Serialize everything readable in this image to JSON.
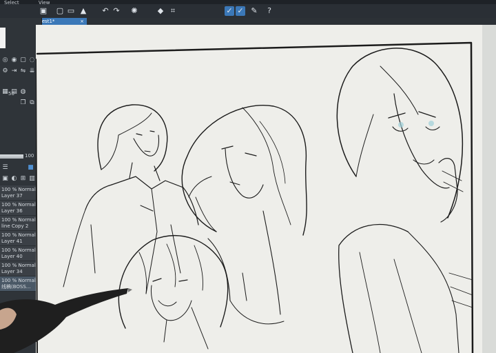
{
  "menubar": {
    "items": [
      "Select",
      "View"
    ]
  },
  "toolbar": {
    "icons": [
      "app-icon",
      "new-file-icon",
      "open-file-icon",
      "save-icon",
      "undo-icon",
      "redo-icon",
      "loading-icon",
      "fill-icon",
      "transform-icon",
      "check-icon",
      "check-active-icon",
      "edit-icon",
      "help-icon"
    ]
  },
  "tabs": [
    {
      "label": "test1*",
      "close": "×"
    }
  ],
  "left_panel": {
    "brush_size": "50",
    "opacity_value": "100",
    "layers": [
      {
        "opacity": "100 % Normal",
        "name": "Layer 37"
      },
      {
        "opacity": "100 % Normal",
        "name": "Layer 36"
      },
      {
        "opacity": "100 % Normal",
        "name": "line Copy 2"
      },
      {
        "opacity": "100 % Normal",
        "name": "Layer 41"
      },
      {
        "opacity": "100 % Normal",
        "name": "Layer 40"
      },
      {
        "opacity": "100 % Normal",
        "name": "Layer 34"
      },
      {
        "opacity": "100 % Normal",
        "name": "线稿(BOSS..."
      }
    ]
  },
  "colors": {
    "accent": "#3b78b8",
    "paper": "#eeeeea",
    "ink": "#1b1b1b",
    "panel": "#2f3439"
  }
}
